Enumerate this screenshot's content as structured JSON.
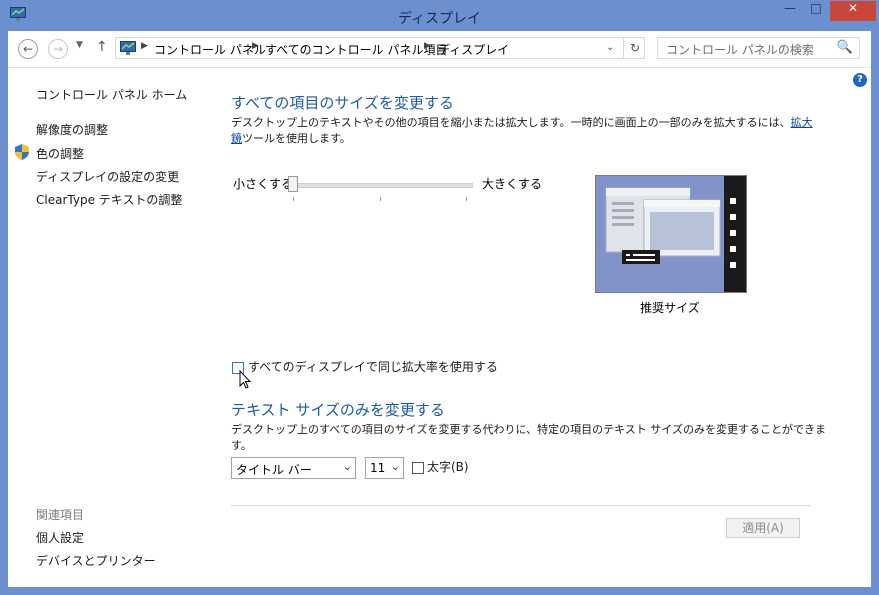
{
  "window": {
    "title": "ディスプレイ",
    "min": "—",
    "max": "□",
    "close": "✕"
  },
  "nav": {
    "back": "←",
    "forward": "→",
    "recent": "▼",
    "up": "↑",
    "refresh": "↻"
  },
  "breadcrumb": [
    "コントロール パネル",
    "すべてのコントロール パネル項目",
    "ディスプレイ"
  ],
  "breadcrumb_separator": "▶",
  "search": {
    "placeholder": "コントロール パネルの検索",
    "icon": "🔍"
  },
  "help": "?",
  "sidebar": {
    "home": "コントロール パネル ホーム",
    "items": [
      "解像度の調整",
      "色の調整",
      "ディスプレイの設定の変更",
      "ClearType テキストの調整"
    ],
    "related_header": "関連項目",
    "related": [
      "個人設定",
      "デバイスとプリンター"
    ]
  },
  "main": {
    "resize_title": "すべての項目のサイズを変更する",
    "resize_desc_1": "デスクトップ上のテキストやその他の項目を縮小または拡大します。一時的に画面上の一部のみを拡大するには、",
    "resize_desc_link": "拡大鏡",
    "resize_desc_2": "ツールを使用します。",
    "slider": {
      "min_label": "小さくする",
      "max_label": "大きくする",
      "level": 0
    },
    "preview_caption": "推奨サイズ",
    "same_scale_checkbox": "すべてのディスプレイで同じ拡大率を使用する",
    "text_title": "テキスト サイズのみを変更する",
    "text_desc": "デスクトップ上のすべての項目のサイズを変更する代わりに、特定の項目のテキスト サイズのみを変更することができます。",
    "item_select": "タイトル バー",
    "size_select": "11",
    "bold_label": "太字(B)",
    "apply": "適用(A)"
  },
  "colors": {
    "titlebar": "#6c8fcf",
    "accent": "#1e5aa8",
    "link": "#0645ad"
  }
}
